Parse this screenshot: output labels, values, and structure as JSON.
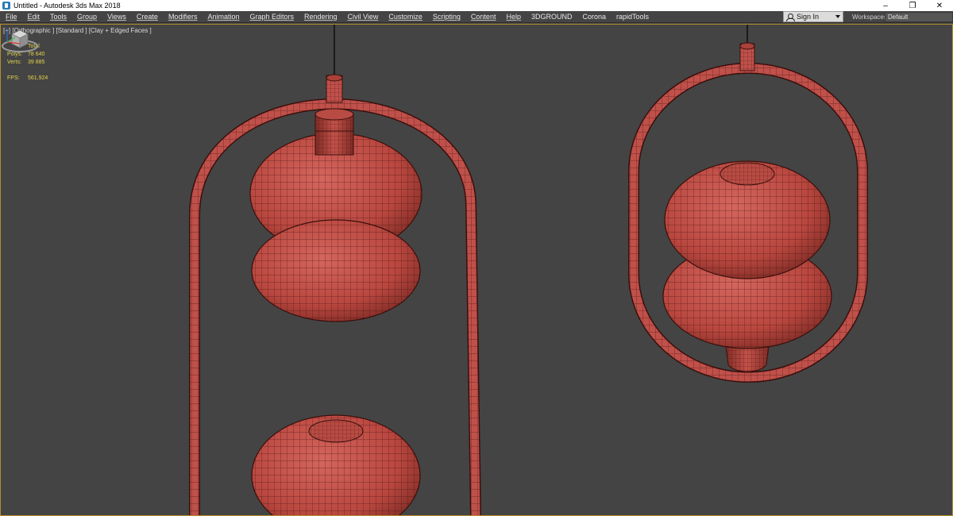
{
  "window": {
    "title": "Untitled - Autodesk 3ds Max 2018",
    "icon": "app-3dsmax-icon",
    "controls": [
      "–",
      "❐",
      "✕"
    ]
  },
  "menu": {
    "items": [
      "File",
      "Edit",
      "Tools",
      "Group",
      "Views",
      "Create",
      "Modifiers",
      "Animation",
      "Graph Editors",
      "Rendering",
      "Civil View",
      "Customize",
      "Scripting",
      "Content",
      "Help",
      "3DGROUND",
      "Corona",
      "rapidTools"
    ]
  },
  "account": {
    "sign_in": "Sign In"
  },
  "workspaces": {
    "label": "Workspaces:",
    "value": "Default"
  },
  "viewport": {
    "label": "[+] [Orthographic ] [Standard ] [Clay + Edged Faces ]",
    "stats": {
      "header": "Total",
      "polys_label": "Polys:",
      "polys_value": "78 640",
      "verts_label": "Verts:",
      "verts_value": "39 885",
      "fps_label": "FPS:",
      "fps_value": "561,924"
    }
  },
  "colors": {
    "viewport_bg": "#444444",
    "mesh_fill": "#c0504a",
    "wire": "#3a0f0c",
    "stats_text": "#e3d24a",
    "viewport_border": "#b58e2c"
  }
}
